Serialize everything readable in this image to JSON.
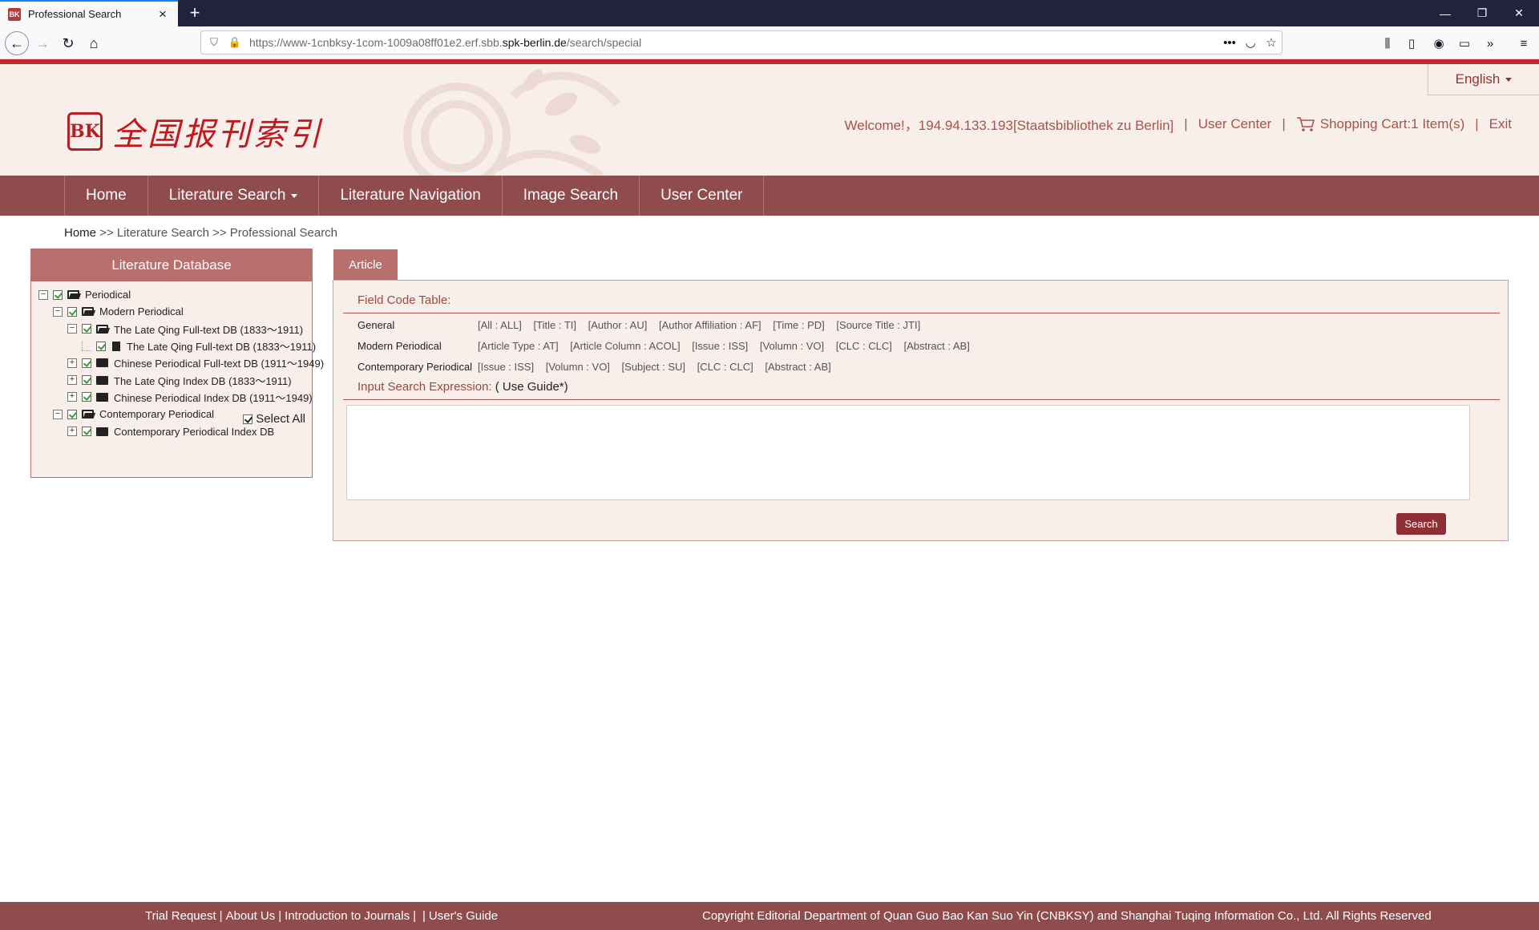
{
  "browser": {
    "tab_title": "Professional Search",
    "tab_favicon": "cnbksy-favicon",
    "new_tab": "+",
    "url_prefix": "https://www-1cnbksy-1com-1009a08ff01e2.erf.sbb.",
    "url_domain": "spk-berlin.de",
    "url_path": "/search/special",
    "url_more": "•••",
    "window_controls": [
      "—",
      "❐",
      "✕"
    ]
  },
  "header": {
    "language": "English",
    "logo_seal": "BK",
    "logo_text": "全国报刊索引",
    "welcome": "Welcome!，194.94.133.193[Staatsbibliothek zu Berlin]",
    "user_center": "User Center",
    "shopping_cart": "Shopping Cart:1 Item(s)",
    "exit": "Exit",
    "sep": "|"
  },
  "menu": {
    "items": [
      "Home",
      "Literature Search",
      "Literature Navigation",
      "Image Search",
      "User Center"
    ]
  },
  "breadcrumb": {
    "home": "Home",
    "rest": " >> Literature Search >> Professional Search"
  },
  "sidebar": {
    "title": "Literature Database",
    "tree": [
      "Periodical",
      "Modern Periodical",
      "The Late Qing Full-text DB (1833～1911)",
      "The Late Qing Full-text DB (1833～1911)",
      "Chinese Periodical Full-text DB (1911～1949)",
      "The Late Qing Index DB (1833～1911)",
      "Chinese Periodical Index DB (1911～1949)",
      "Contemporary Periodical",
      "Contemporary Periodical Index DB"
    ],
    "select_all": "Select All"
  },
  "content": {
    "tab": "Article",
    "field_code_title": "Field Code Table:",
    "rows": [
      {
        "label": "General",
        "codes": [
          "[All : ALL]",
          "[Title : TI]",
          "[Author : AU]",
          "[Author Affiliation : AF]",
          "[Time : PD]",
          "[Source Title : JTI]"
        ]
      },
      {
        "label": "Modern Periodical",
        "codes": [
          "[Article Type : AT]",
          "[Article Column : ACOL]",
          "[Issue : ISS]",
          "[Volumn : VO]",
          "[CLC : CLC]",
          "[Abstract : AB]"
        ]
      },
      {
        "label": "Contemporary Periodical",
        "codes": [
          "[Issue : ISS]",
          "[Volumn : VO]",
          "[Subject : SU]",
          "[CLC : CLC]",
          "[Abstract : AB]"
        ]
      }
    ],
    "input_title": "Input Search Expression:",
    "use_guide": " ( Use Guide*)",
    "expression_value": "",
    "search_button": "Search"
  },
  "footer": {
    "links": [
      "Trial Request",
      "About Us",
      "Introduction to Journals",
      "",
      "User's Guide"
    ],
    "copyright": "Copyright Editorial Department of Quan Guo Bao Kan Suo Yin (CNBKSY) and Shanghai Tuqing Information Co., Ltd. All Rights Reserved"
  },
  "colors": {
    "brand_red": "#c0282d",
    "menu_bg": "#904c4d",
    "panel_bg": "#f8eeea",
    "accent": "#b8706c"
  }
}
